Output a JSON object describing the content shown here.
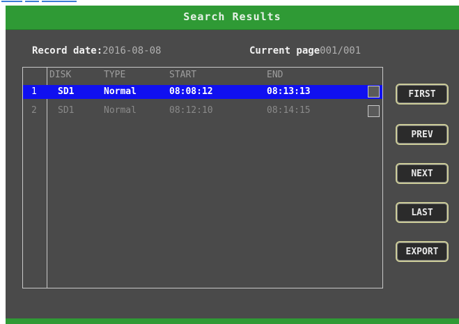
{
  "window": {
    "title": "Search Results"
  },
  "info": {
    "record_date_label": "Record date:",
    "record_date_value": "2016-08-08",
    "current_page_label": "Current page",
    "current_page_value": "001/001"
  },
  "list": {
    "columns": [
      "DISK",
      "TYPE",
      "START",
      "END"
    ],
    "rows": [
      {
        "index": "1",
        "disk": "SD1",
        "type": "Normal",
        "start": "08:08:12",
        "end": "08:13:13",
        "selected": true
      },
      {
        "index": "2",
        "disk": "SD1",
        "type": "Normal",
        "start": "08:12:10",
        "end": "08:14:15",
        "selected": false
      }
    ]
  },
  "buttons": {
    "first": "FIRST",
    "prev": "PREV",
    "next": "NEXT",
    "last": "LAST",
    "export": "EXPORT"
  },
  "colors": {
    "title_bar": "#2f9a35",
    "background": "#4a4a4a",
    "selection": "#1010f0"
  }
}
